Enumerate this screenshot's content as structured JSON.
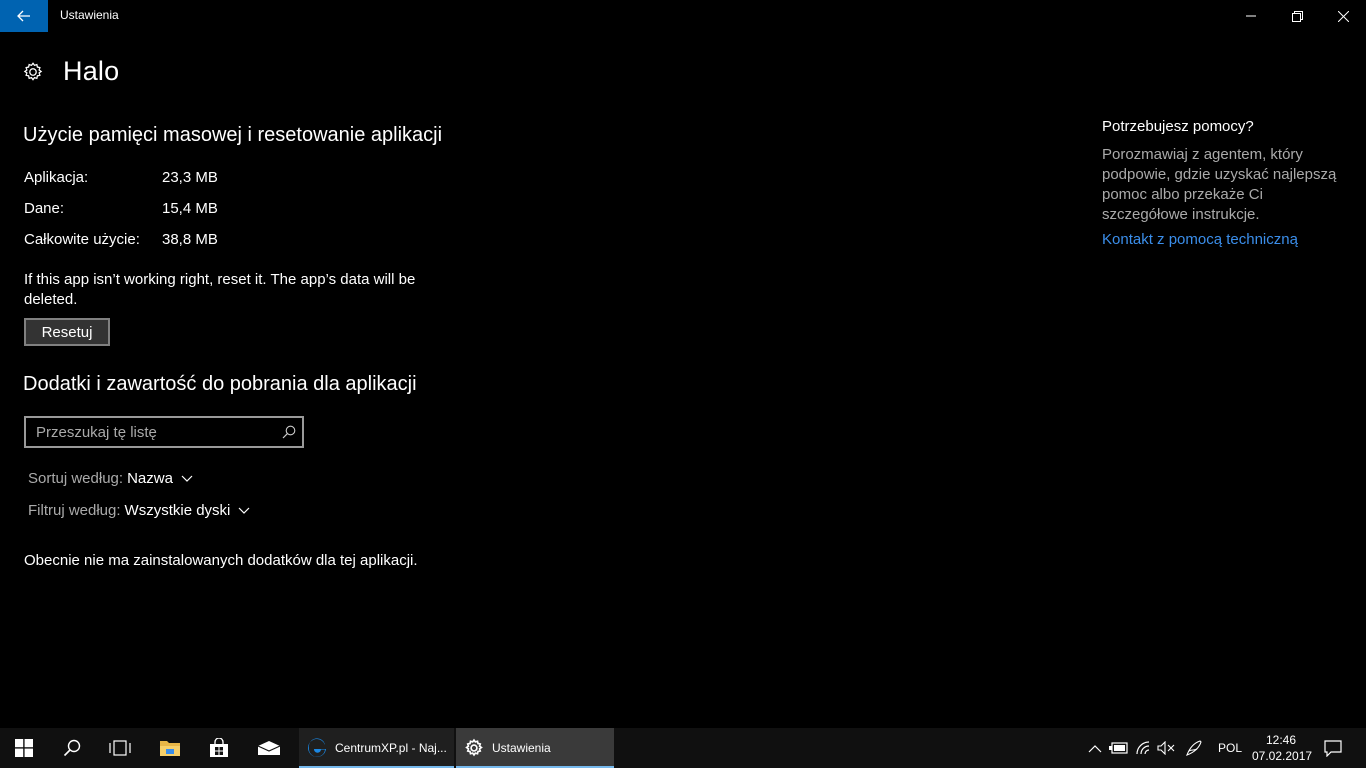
{
  "window": {
    "title": "Ustawienia"
  },
  "page": {
    "title": "Halo"
  },
  "storage": {
    "section_title": "Użycie pamięci masowej i resetowanie aplikacji",
    "rows": [
      {
        "label": "Aplikacja:",
        "value": "23,3 MB"
      },
      {
        "label": "Dane:",
        "value": "15,4 MB"
      },
      {
        "label": "Całkowite użycie:",
        "value": "38,8 MB"
      }
    ],
    "reset_note": "If this app isn’t working right, reset it. The app’s data will be deleted.",
    "reset_button": "Resetuj"
  },
  "addons": {
    "section_title": "Dodatki i zawartość do pobrania dla aplikacji",
    "search_placeholder": "Przeszukaj tę listę",
    "sort_label": "Sortuj według:",
    "sort_value": "Nazwa",
    "filter_label": "Filtruj według:",
    "filter_value": "Wszystkie dyski",
    "empty_message": "Obecnie nie ma zainstalowanych dodatków dla tej aplikacji."
  },
  "help": {
    "title": "Potrzebujesz pomocy?",
    "text": "Porozmawiaj z agentem, który podpowie, gdzie uzyskać najlepszą pomoc albo przekaże Ci szczegółowe instrukcje.",
    "link": "Kontakt z pomocą techniczną"
  },
  "taskbar": {
    "apps": [
      {
        "label": "CentrumXP.pl - Naj..."
      },
      {
        "label": "Ustawienia"
      }
    ],
    "language": "POL",
    "time": "12:46",
    "date": "07.02.2017"
  },
  "colors": {
    "accent": "#0063b1",
    "link": "#3b8eea",
    "taskbar_underline": "#76b9ed"
  }
}
